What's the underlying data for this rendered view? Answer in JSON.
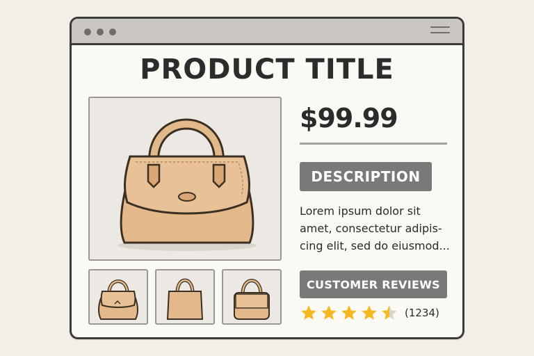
{
  "window": {
    "dot_count": 3,
    "colors": {
      "frame": "#3a3a3a",
      "titlebar": "#c9c6c2",
      "background": "#fbf9f4"
    }
  },
  "product": {
    "title": "PRODUCT TITLE",
    "price": "$99.99",
    "main_image_icon": "handbag-icon",
    "thumbnails": [
      {
        "icon": "handbag-thumbnail-icon"
      },
      {
        "icon": "tote-bag-thumbnail-icon"
      },
      {
        "icon": "satchel-thumbnail-icon"
      }
    ]
  },
  "description": {
    "label": "DESCRIPTION",
    "lines": [
      "Lorem ipsum dolor sit",
      "amet, consectetur  adipis-",
      "cing elit, sed do eiusmod..."
    ]
  },
  "reviews": {
    "label": "CUSTOMER REVIEWS",
    "rating": 4.5,
    "max_rating": 5,
    "count_label": "(1234)",
    "star_color": "#f5b820"
  }
}
